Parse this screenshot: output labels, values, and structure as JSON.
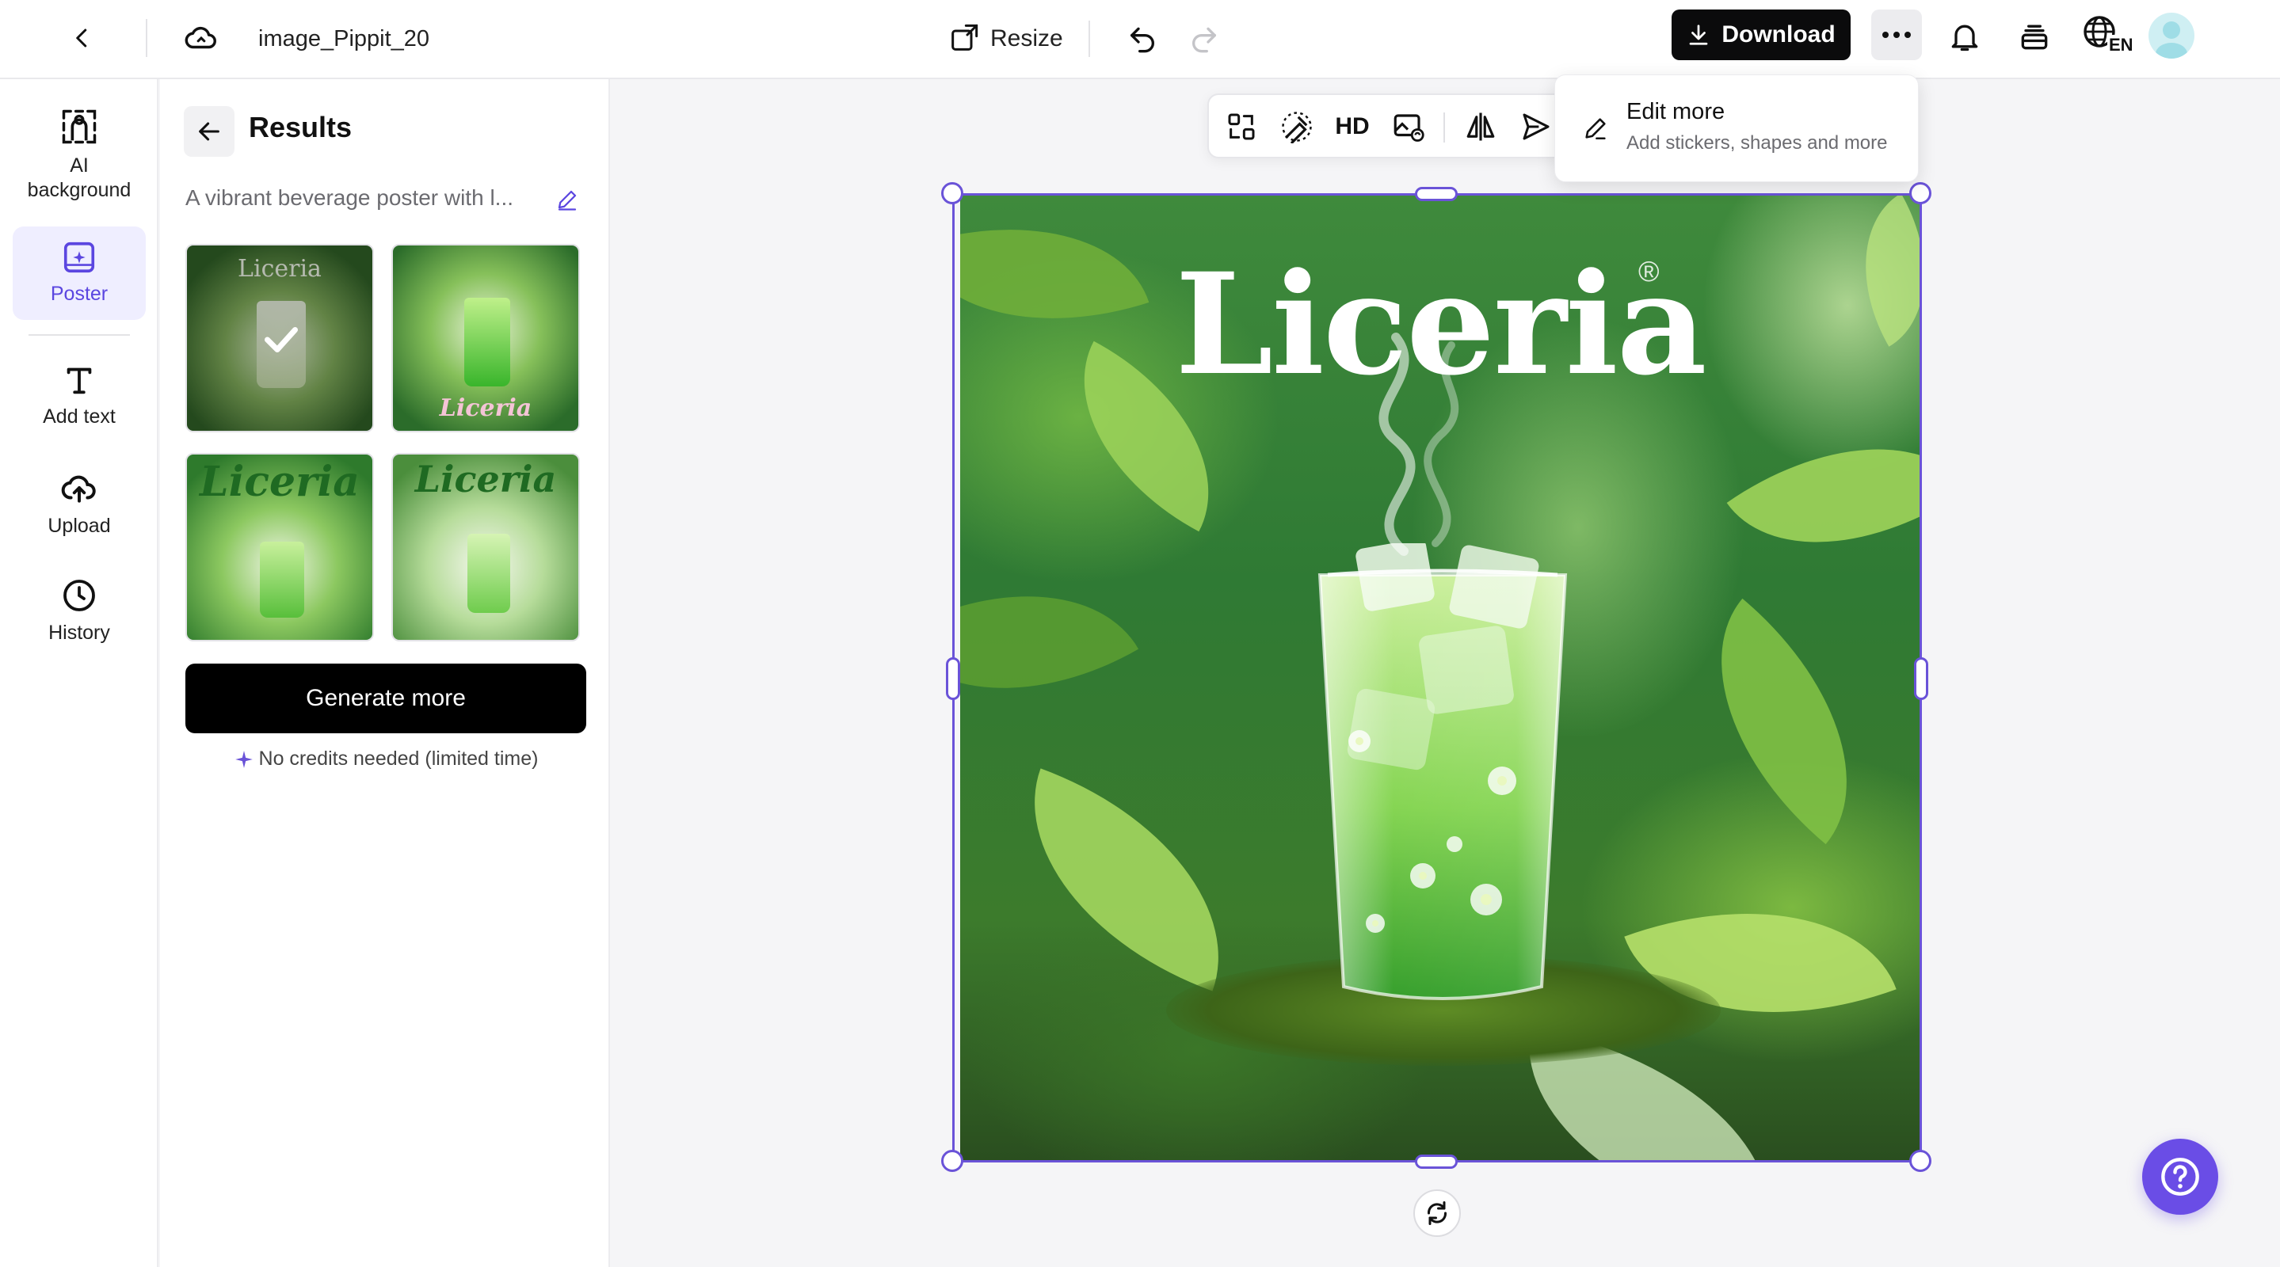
{
  "header": {
    "back_label": "Back",
    "project_title": "image_Pippit_20",
    "resize_label": "Resize",
    "download_label": "Download",
    "language_badge": "EN"
  },
  "rail": {
    "items": [
      {
        "label_line1": "AI",
        "label_line2": "background",
        "icon": "ai-background-icon"
      },
      {
        "label": "Poster",
        "icon": "poster-icon",
        "active": true
      },
      {
        "label": "Add text",
        "icon": "text-icon"
      },
      {
        "label": "Upload",
        "icon": "upload-cloud-icon"
      },
      {
        "label": "History",
        "icon": "clock-icon"
      }
    ]
  },
  "results": {
    "title": "Results",
    "prompt": "A vibrant beverage poster with l...",
    "thumbnails": [
      {
        "text": "Liceria",
        "selected": true
      },
      {
        "text": "Liceria",
        "selected": false
      },
      {
        "text": "Liceria",
        "selected": false
      },
      {
        "text": "Liceria",
        "selected": false
      }
    ],
    "generate_label": "Generate more",
    "credits_note": "No credits needed (limited time)"
  },
  "toolbar": {
    "hd_label": "HD",
    "icons": [
      "expand-icon",
      "magic-eraser-icon",
      "hd-icon",
      "image-replace-icon",
      "flip-icon",
      "send-icon"
    ]
  },
  "dropdown": {
    "title": "Edit more",
    "subtitle": "Add stickers, shapes and more"
  },
  "canvas": {
    "brand_text": "Liceria",
    "reg_mark": "®"
  },
  "colors": {
    "accent": "#6a53d8",
    "help_button": "#6a4de6",
    "download_bg": "#0b0b0c"
  }
}
